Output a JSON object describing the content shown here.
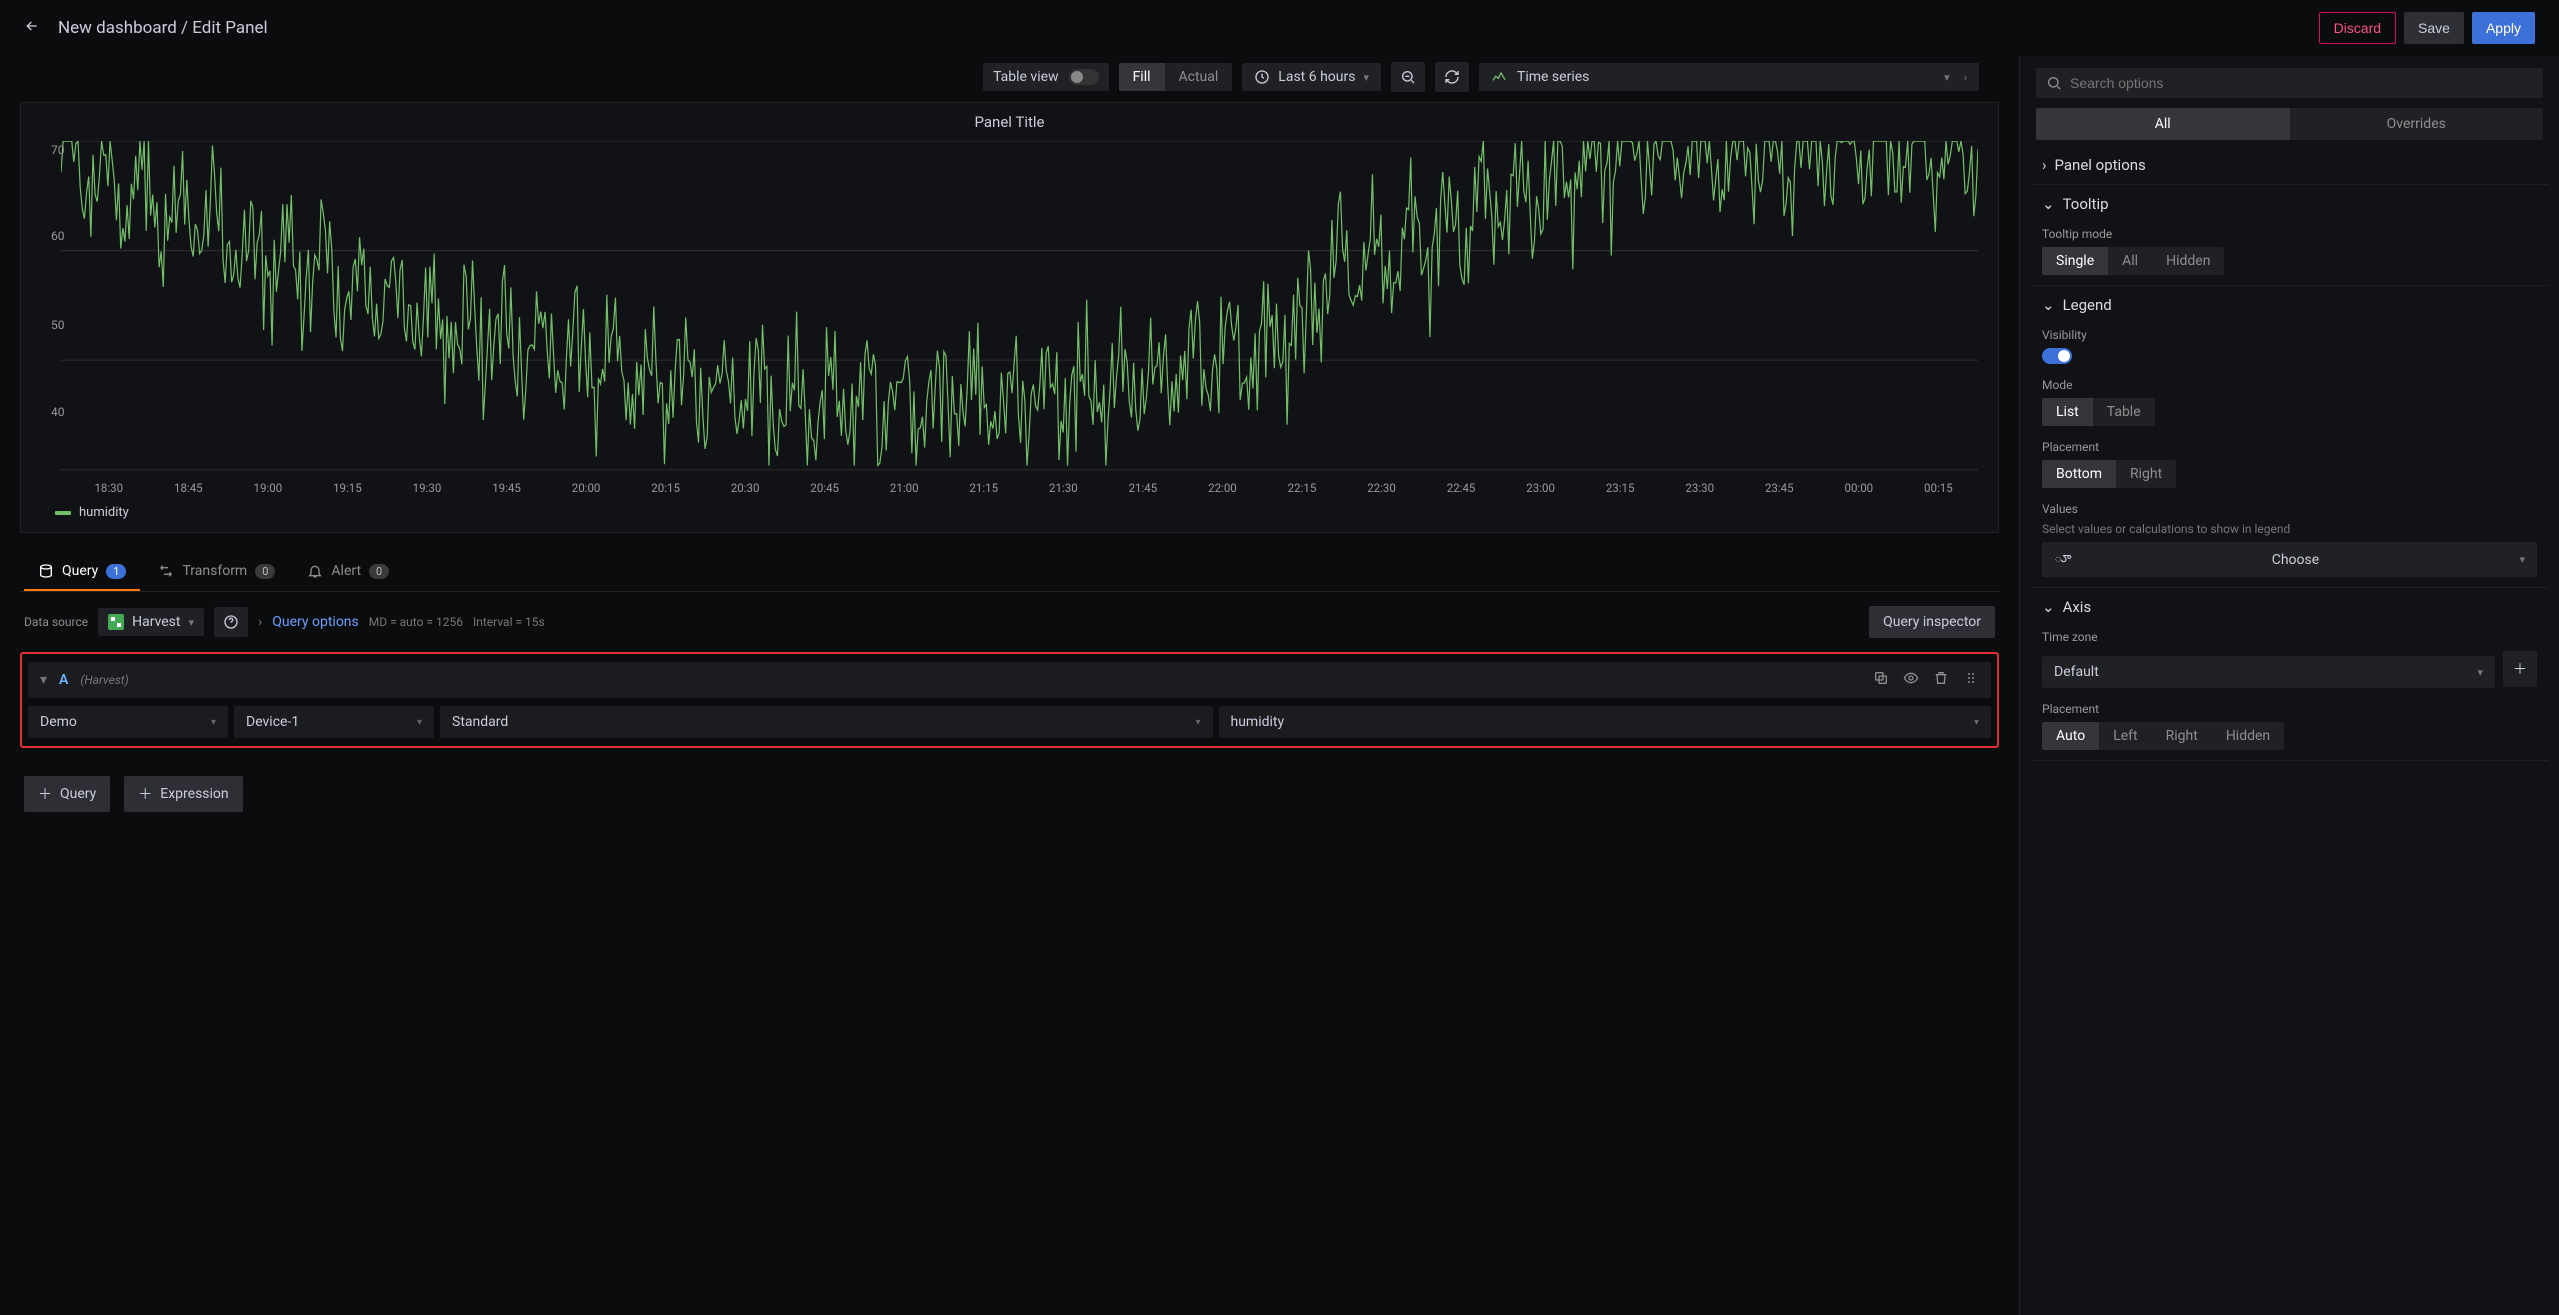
{
  "breadcrumb": "New dashboard / Edit Panel",
  "header_buttons": {
    "discard": "Discard",
    "save": "Save",
    "apply": "Apply"
  },
  "toolbar": {
    "table_view": "Table view",
    "fill": "Fill",
    "actual": "Actual",
    "time_label": "Last 6 hours",
    "viz_label": "Time series"
  },
  "panel": {
    "title": "Panel Title"
  },
  "chart_data": {
    "type": "line",
    "title": "Panel Title",
    "xlabel": "",
    "ylabel": "",
    "ylim": [
      40,
      70
    ],
    "y_ticks": [
      70,
      60,
      50,
      40
    ],
    "x_ticks": [
      "18:30",
      "18:45",
      "19:00",
      "19:15",
      "19:30",
      "19:45",
      "20:00",
      "20:15",
      "20:30",
      "20:45",
      "21:00",
      "21:15",
      "21:30",
      "21:45",
      "22:00",
      "22:15",
      "22:30",
      "22:45",
      "23:00",
      "23:15",
      "23:30",
      "23:45",
      "00:00",
      "00:15"
    ],
    "series": [
      {
        "name": "humidity",
        "color": "#73bf69"
      }
    ],
    "legend": [
      "humidity"
    ]
  },
  "tabs": {
    "query": {
      "label": "Query",
      "count": "1"
    },
    "transform": {
      "label": "Transform",
      "count": "0"
    },
    "alert": {
      "label": "Alert",
      "count": "0"
    }
  },
  "datasource": {
    "label": "Data source",
    "name": "Harvest",
    "query_options": "Query options",
    "md": "MD = auto = 1256",
    "interval": "Interval = 15s",
    "inspector": "Query inspector"
  },
  "query": {
    "letter": "A",
    "ds": "(Harvest)",
    "f1": "Demo",
    "f2": "Device-1",
    "f3": "Standard",
    "f4": "humidity"
  },
  "add": {
    "query": "Query",
    "expression": "Expression"
  },
  "sidebar": {
    "search_placeholder": "Search options",
    "tab_all": "All",
    "tab_overrides": "Overrides",
    "panel_options": "Panel options",
    "tooltip": {
      "title": "Tooltip",
      "mode_label": "Tooltip mode",
      "single": "Single",
      "all": "All",
      "hidden": "Hidden"
    },
    "legend": {
      "title": "Legend",
      "visibility": "Visibility",
      "mode": "Mode",
      "list": "List",
      "table": "Table",
      "placement": "Placement",
      "bottom": "Bottom",
      "right": "Right",
      "values": "Values",
      "values_sub": "Select values or calculations to show in legend",
      "choose": "Choose"
    },
    "axis": {
      "title": "Axis",
      "tz": "Time zone",
      "tz_val": "Default",
      "placement": "Placement",
      "auto": "Auto",
      "left": "Left",
      "right": "Right",
      "hidden": "Hidden"
    }
  }
}
